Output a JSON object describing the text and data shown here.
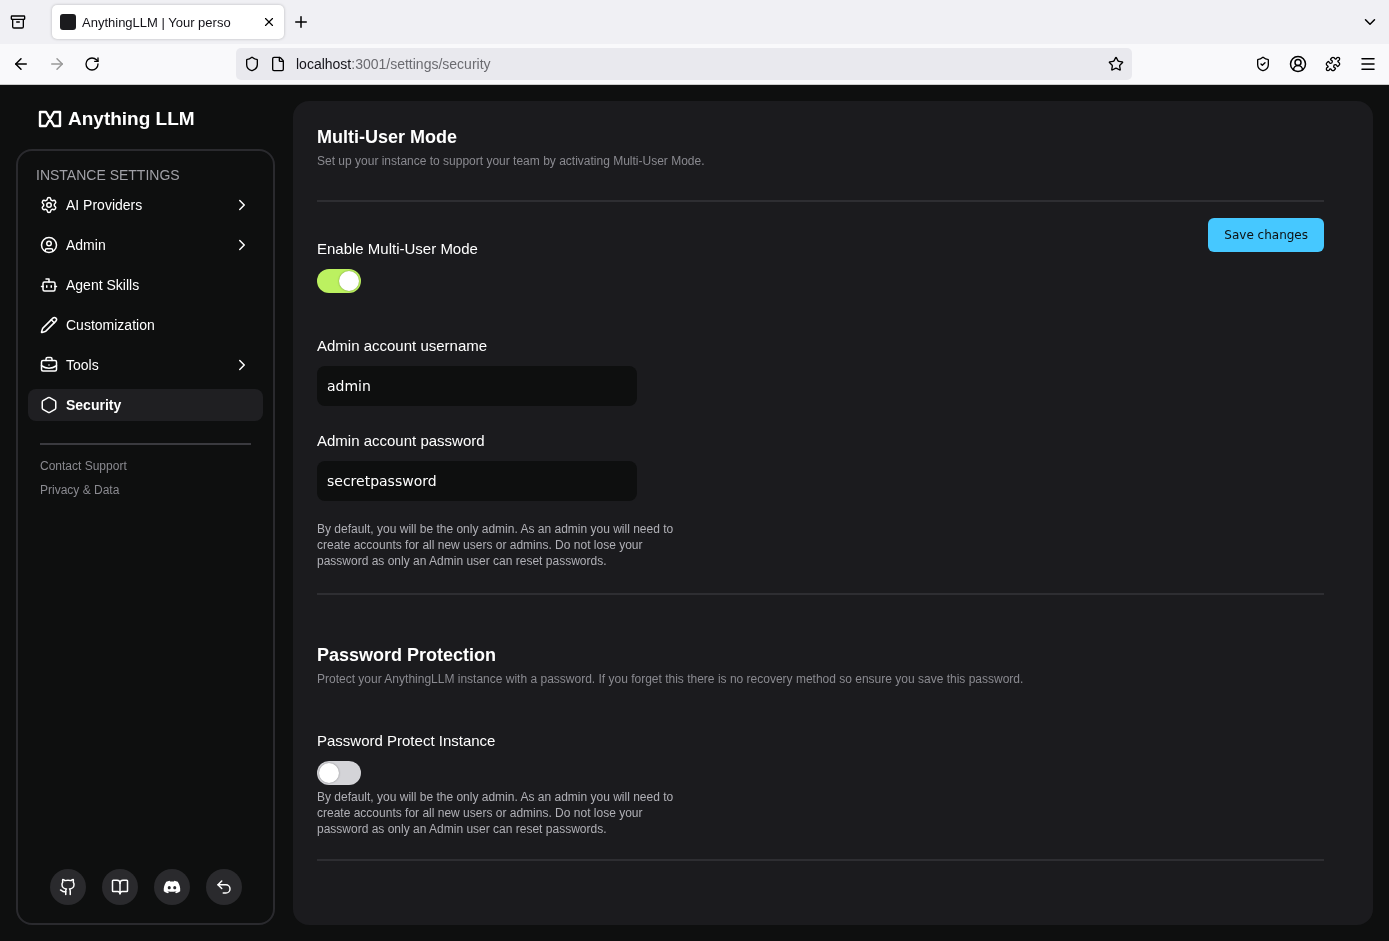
{
  "browser": {
    "tab_title": "AnythingLLM | Your perso",
    "url_host": "localhost",
    "url_path": ":3001/settings/security"
  },
  "sidebar": {
    "logo": "Anything LLM",
    "section_title": "INSTANCE SETTINGS",
    "items": [
      {
        "kind": "gear",
        "label": "AI Providers",
        "has_submenu": true,
        "selected": false
      },
      {
        "kind": "user",
        "label": "Admin",
        "has_submenu": true,
        "selected": false
      },
      {
        "kind": "bot",
        "label": "Agent Skills",
        "has_submenu": false,
        "selected": false
      },
      {
        "kind": "pencil",
        "label": "Customization",
        "has_submenu": false,
        "selected": false
      },
      {
        "kind": "toolbox",
        "label": "Tools",
        "has_submenu": true,
        "selected": false
      },
      {
        "kind": "shield",
        "label": "Security",
        "has_submenu": false,
        "selected": true
      }
    ],
    "links": [
      "Contact Support",
      "Privacy & Data"
    ],
    "footer_buttons": [
      {
        "kind": "github"
      },
      {
        "kind": "book"
      },
      {
        "kind": "discord"
      },
      {
        "kind": "back"
      }
    ]
  },
  "multi_user": {
    "title": "Multi-User Mode",
    "description": "Set up your instance to support your team by activating Multi-User Mode.",
    "save_button": "Save changes",
    "toggle": {
      "label": "Enable Multi-User Mode",
      "on": true
    },
    "fields": [
      {
        "label": "Admin account username",
        "value": "admin"
      },
      {
        "label": "Admin account password",
        "value": "secretpassword"
      }
    ],
    "help": "By default, you will be the only admin. As an admin you will need to create accounts for all new users or admins. Do not lose your password as only an Admin user can reset passwords."
  },
  "password_protection": {
    "title": "Password Protection",
    "description": "Protect your AnythingLLM instance with a password. If you forget this there is no recovery method so ensure you save this password.",
    "toggle": {
      "label": "Password Protect Instance",
      "on": false
    },
    "help": "By default, you will be the only admin. As an admin you will need to create accounts for all new users or admins. Do not lose your password as only an Admin user can reset passwords."
  }
}
